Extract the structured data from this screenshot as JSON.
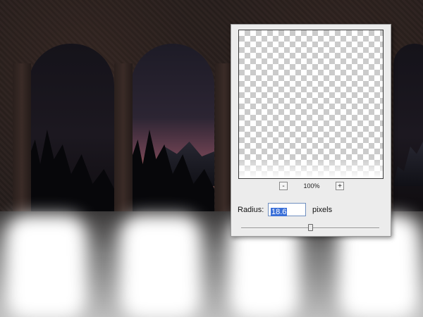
{
  "dialog": {
    "zoom": {
      "minus_label": "-",
      "plus_label": "+",
      "value": "100%"
    },
    "radius": {
      "label": "Radius:",
      "value": "18.6",
      "unit": "pixels"
    },
    "slider": {
      "fraction": 0.5
    }
  },
  "scene": {
    "description_visible": ""
  }
}
